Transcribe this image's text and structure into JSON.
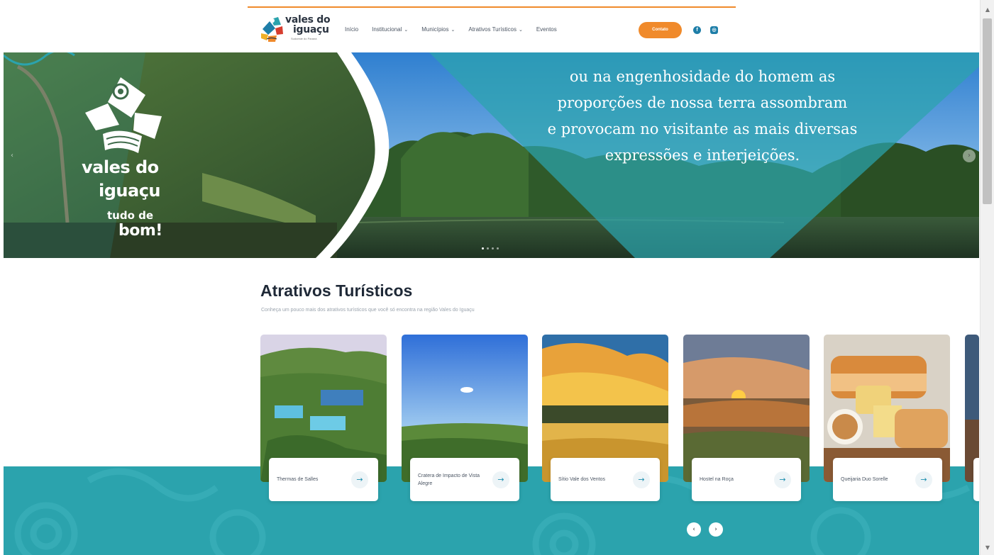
{
  "brand": {
    "name_line1": "vales do",
    "name_line2": "iguaçu",
    "tagline": "Sudoeste do Paraná"
  },
  "nav": [
    {
      "label": "Início",
      "has_menu": false
    },
    {
      "label": "Institucional",
      "has_menu": true,
      "chevron": "⌄"
    },
    {
      "label": "Municípios",
      "has_menu": true,
      "chevron": "⌄"
    },
    {
      "label": "Atrativos Turísticos",
      "has_menu": true,
      "chevron": "⌄"
    },
    {
      "label": "Eventos",
      "has_menu": false
    }
  ],
  "header": {
    "contact_label": "Contato",
    "social": [
      {
        "icon": "facebook-icon",
        "glyph": "f"
      },
      {
        "icon": "instagram-icon",
        "glyph": "◎"
      }
    ]
  },
  "hero": {
    "quote_lines": [
      "ou na engenhosidade do homem as",
      "proporções de nossa terra assombram",
      "e provocam no visitante as mais diversas",
      "expressões e interjeições."
    ],
    "logo_line1": "vales do",
    "logo_line2": "iguaçu",
    "logo_line3": "tudo de",
    "logo_line4": "bom!",
    "prev_glyph": "‹",
    "next_glyph": "›",
    "slide_count": 4,
    "active_slide": 0
  },
  "section": {
    "title": "Atrativos Turísticos",
    "subtitle": "Conheça um pouco mais dos atrativos turísticos que você só encontra na região Vales do Iguaçu"
  },
  "cards": [
    {
      "label": "Thermas de Salles",
      "arrow": "→"
    },
    {
      "label": "Cratera de Impacto de Vista Alegre",
      "arrow": "→"
    },
    {
      "label": "Sítio Vale dos Ventos",
      "arrow": "→"
    },
    {
      "label": "Hostel na Roça",
      "arrow": "→"
    },
    {
      "label": "Queijaria Duo Sorelle",
      "arrow": "→"
    }
  ],
  "carousel": {
    "prev_glyph": "‹",
    "next_glyph": "›"
  },
  "colors": {
    "accent_orange": "#f08a2b",
    "teal": "#2ba3ad",
    "social_blue": "#1e7ea8",
    "heading": "#1f2937"
  }
}
